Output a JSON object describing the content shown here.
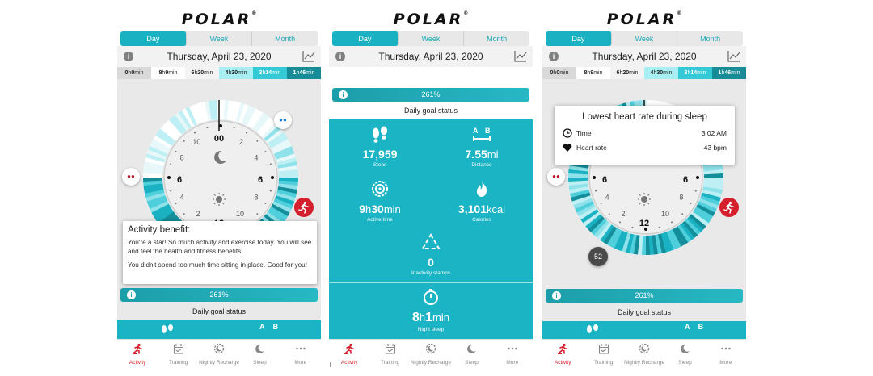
{
  "brand": "POLAR",
  "brand_mark": "®",
  "tabs": [
    "Day",
    "Week",
    "Month"
  ],
  "date": "Thursday, April 23, 2020",
  "intensity": [
    {
      "num1": "0",
      "u1": "h",
      "num2": "0",
      "u2": "min",
      "bg": "#d9d9d9",
      "fg": "#222"
    },
    {
      "num1": "8",
      "u1": "h",
      "num2": "9",
      "u2": "min",
      "bg": "#ffffff",
      "fg": "#222"
    },
    {
      "num1": "6",
      "u1": "h",
      "num2": "20",
      "u2": "min",
      "bg": "#f3f3f3",
      "fg": "#222"
    },
    {
      "num1": "4",
      "u1": "h",
      "num2": "30",
      "u2": "min",
      "bg": "#a8eef3",
      "fg": "#222"
    },
    {
      "num1": "3",
      "u1": "h",
      "num2": "14",
      "u2": "min",
      "bg": "#34c9d6",
      "fg": "#ffffff"
    },
    {
      "num1": "1",
      "u1": "h",
      "num2": "46",
      "u2": "min",
      "bg": "#178c97",
      "fg": "#ffffff"
    }
  ],
  "clock": {
    "top": "00",
    "bottom": "12",
    "left": "6",
    "right": "6",
    "ticks": [
      "10",
      "2",
      "8",
      "4",
      "4",
      "8",
      "2",
      "10"
    ]
  },
  "activity_popup": {
    "title": "Activity benefit:",
    "line1": "You're a star! So much activity and exercise today. You will see and feel the health and fitness benefits.",
    "line2": "You didn't spend too much time sitting in place. Good for you!"
  },
  "goal": {
    "value": "261%",
    "label": "Daily goal status"
  },
  "stats": {
    "steps": {
      "value": "17,959",
      "label": "Steps"
    },
    "distance": {
      "value": "7.55",
      "unit": "mi",
      "label": "Distance"
    },
    "active": {
      "h": "9",
      "hu": "h",
      "m": "30",
      "mu": "min",
      "label": "Active time"
    },
    "calories": {
      "value": "3,101",
      "unit": "kcal",
      "label": "Calories"
    },
    "inactivity": {
      "value": "0",
      "label": "Inactivity stamps"
    },
    "sleep": {
      "h": "8",
      "hu": "h",
      "m": "1",
      "mu": "min",
      "label": "Night sleep"
    }
  },
  "hr_popup": {
    "title": "Lowest heart rate during sleep",
    "time_label": "Time",
    "time_value": "3:02 AM",
    "hr_label": "Heart rate",
    "hr_value": "43 bpm"
  },
  "hr_marker": "52",
  "nav": [
    "Activity",
    "Training",
    "Nightly Recharge",
    "Sleep",
    "More"
  ],
  "colors": {
    "accent": "#1bb4c4",
    "active_nav": "#d4202c"
  }
}
